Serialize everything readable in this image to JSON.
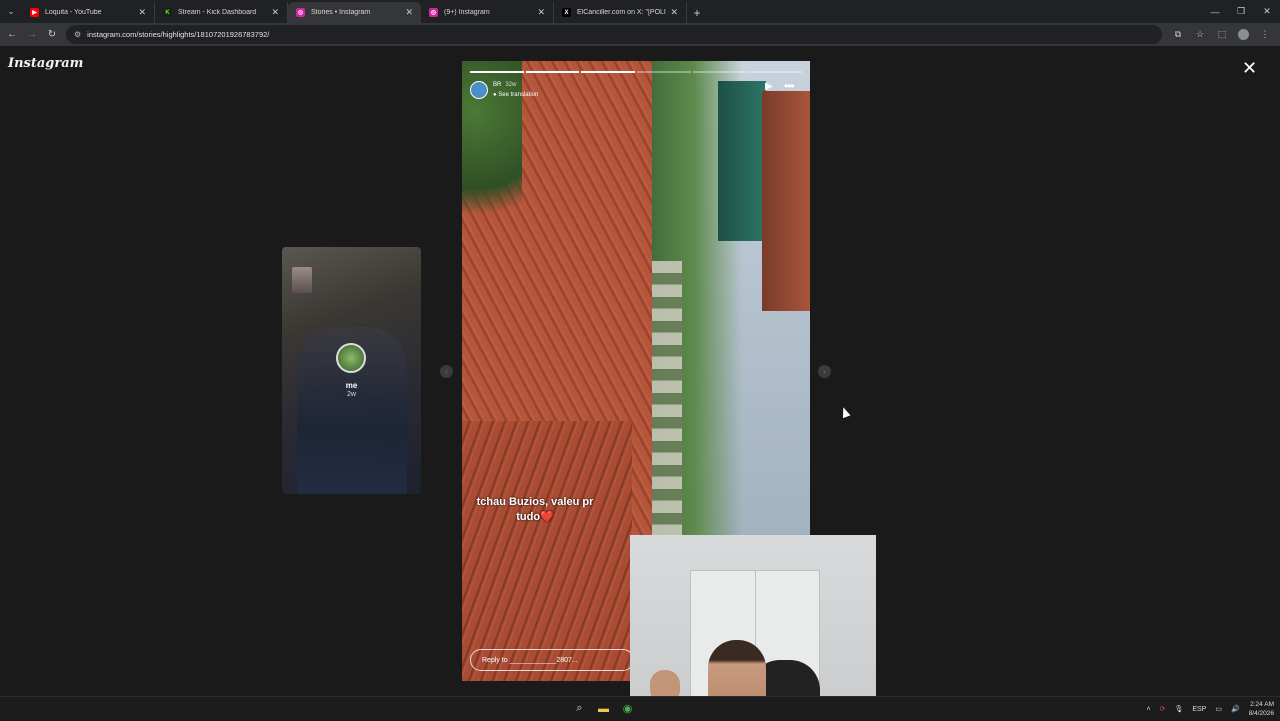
{
  "browser": {
    "tabs": [
      {
        "title": "Loquita - YouTube",
        "favicon_color": "#ff0000",
        "active": false
      },
      {
        "title": "Stream - Kick Dashboard",
        "favicon_color": "#53fc18",
        "active": false
      },
      {
        "title": "Stories • Instagram",
        "favicon_color": "#d6249f",
        "active": true
      },
      {
        "title": "(9+) Instagram",
        "favicon_color": "#d6249f",
        "active": false
      },
      {
        "title": "ElCanciller.com on X: \"[POLICIA...",
        "favicon_color": "#000000",
        "active": false
      }
    ],
    "url": "instagram.com/stories/highlights/18107201926783792/"
  },
  "instagram": {
    "logo": "Instagram",
    "prev_story": {
      "username": "me",
      "time": "2w"
    },
    "story": {
      "username": "BR",
      "time": "32w",
      "see_translation": "See translation",
      "caption_line1": "tchau Buzios, valeu pr",
      "caption_line2": "tudo❤️",
      "reply_placeholder": "Reply to ____________2807..."
    }
  },
  "taskbar": {
    "lang": "ESP",
    "time": "2:24 AM",
    "date": "8/4/2026"
  }
}
